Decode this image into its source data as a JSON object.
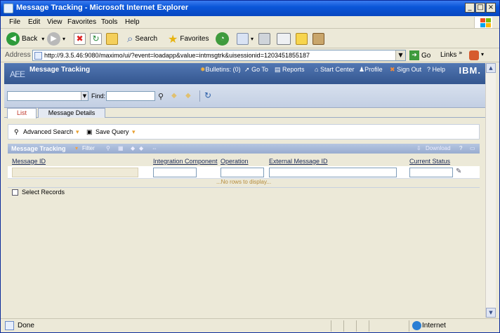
{
  "window": {
    "title": "Message Tracking - Microsoft Internet Explorer"
  },
  "menu": [
    "File",
    "Edit",
    "View",
    "Favorites",
    "Tools",
    "Help"
  ],
  "toolbar": {
    "back": "Back",
    "search": "Search",
    "favorites": "Favorites"
  },
  "address": {
    "label": "Address",
    "url": "http://9.3.5.46:9080/maximo/ui/?event=loadapp&value=intmsgtrk&uisessionid=1203451855187",
    "go": "Go",
    "links": "Links"
  },
  "app_header": {
    "logo": "AEE",
    "title": "Message Tracking",
    "nav": [
      "Bulletins: (0)",
      "Go To",
      "Reports",
      "Start Center",
      "Profile",
      "Sign Out",
      "Help"
    ],
    "brand": "IBM."
  },
  "app_toolbar": {
    "find_label": "Find:",
    "query_value": "",
    "find_value": ""
  },
  "tabs": [
    "List",
    "Message Details"
  ],
  "actions": {
    "advanced_search": "Advanced Search",
    "save_query": "Save Query"
  },
  "table": {
    "title": "Message Tracking",
    "filter": "Filter",
    "download": "Download",
    "columns": [
      "Message ID",
      "Integration Component",
      "Operation",
      "External Message ID",
      "Current Status"
    ],
    "empty": "...No rows to display...",
    "select_records": "Select Records"
  },
  "status": {
    "text": "Done",
    "zone": "Internet"
  },
  "colors": {
    "titlebar": "#0a56d8",
    "app_header": "#3d5f96",
    "active_tab": "#c0392b"
  }
}
